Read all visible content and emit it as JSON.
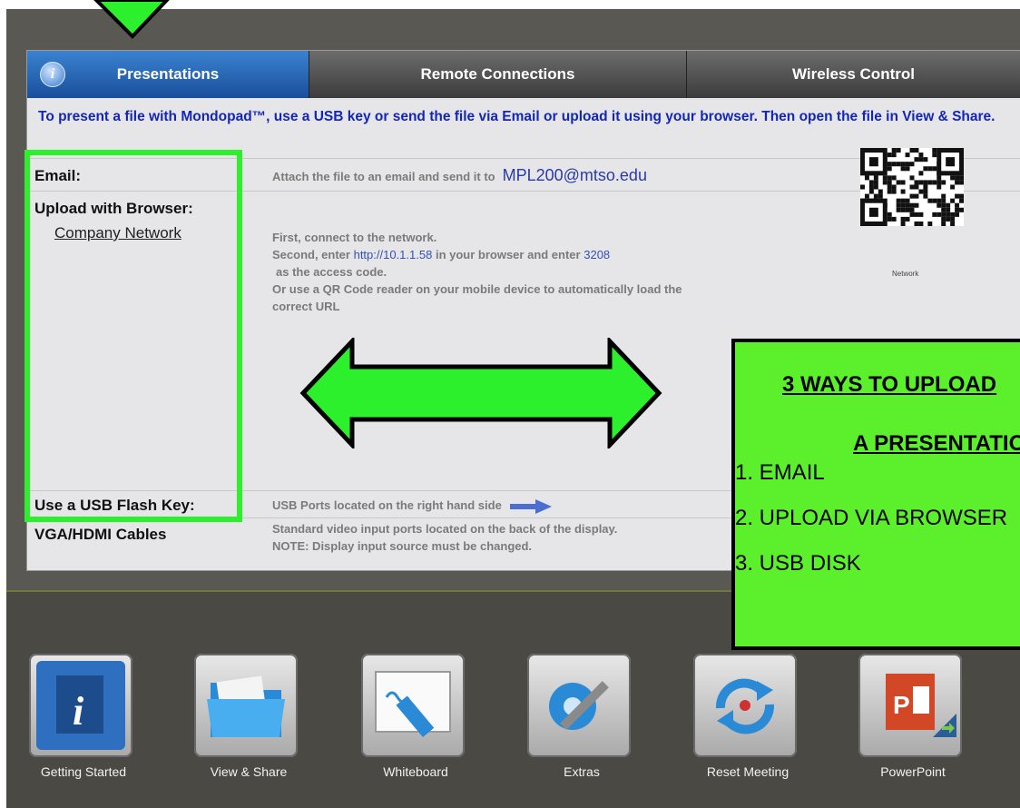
{
  "tabs": [
    {
      "label": "Presentations",
      "active": true
    },
    {
      "label": "Remote Connections",
      "active": false
    },
    {
      "label": "Wireless Control",
      "active": false
    }
  ],
  "intro_text": "To present a file with Mondopad™, use a USB key or send the file via Email or upload it using your browser.  Then open the file in View & Share.",
  "email": {
    "label": "Email:",
    "instruction": "Attach the file to an email and send it to",
    "address": "MPL200@mtso.edu"
  },
  "upload": {
    "label": "Upload with Browser:",
    "network_link": "Company Network",
    "line1": "First, connect to the network.",
    "line2_prefix": "Second, enter",
    "url": "http://10.1.1.58",
    "line2_mid": "in your browser and enter",
    "access_code": "3208",
    "line3": "as the access code.",
    "line4": "Or use a QR Code reader on your mobile device to automatically load the",
    "line5": "correct URL",
    "qr_caption": "Network"
  },
  "usb": {
    "label": "Use a USB Flash Key:",
    "text": "USB Ports located on the right hand side"
  },
  "vga": {
    "label": "VGA/HDMI Cables",
    "line1": "Standard video input ports located on the back of the display.",
    "line2": "NOTE: Display input source must be changed."
  },
  "callout": {
    "heading1": "3 WAYS TO UPLOAD",
    "heading2": "A PRESENTATION",
    "items": [
      "1.  EMAIL",
      "2.  UPLOAD VIA BROWSER",
      "3.  USB DISK"
    ],
    "color": "#5cf02c"
  },
  "dock": [
    {
      "label": "Getting Started",
      "icon": "info-book-icon"
    },
    {
      "label": "View & Share",
      "icon": "folder-icon"
    },
    {
      "label": "Whiteboard",
      "icon": "marker-board-icon"
    },
    {
      "label": "Extras",
      "icon": "tools-gear-icon"
    },
    {
      "label": "Reset Meeting",
      "icon": "reset-arrows-icon"
    },
    {
      "label": "PowerPoint",
      "icon": "powerpoint-icon"
    }
  ],
  "colors": {
    "highlight_green": "#2df02d",
    "active_tab_blue": "#1a4f9c",
    "intro_text_blue": "#1326b8"
  }
}
